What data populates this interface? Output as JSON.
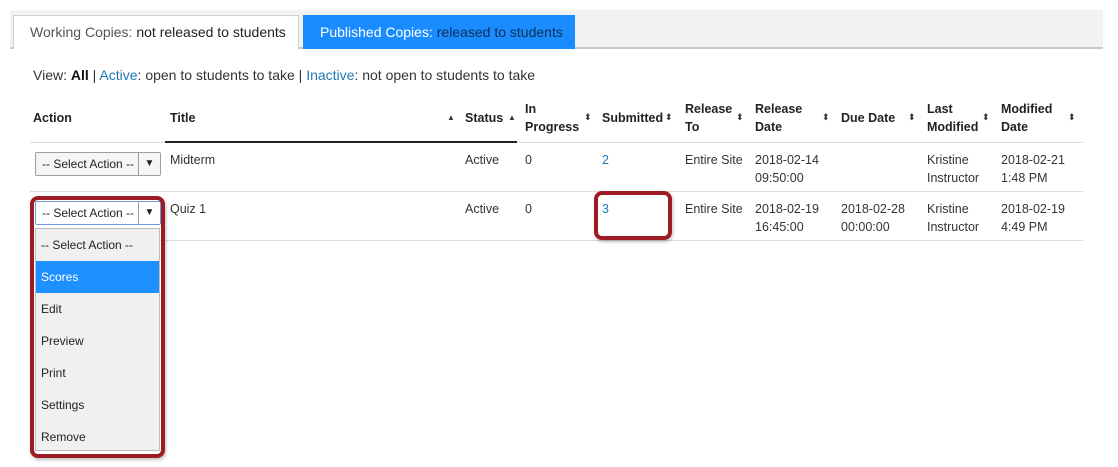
{
  "tabs": [
    {
      "name": "Working Copies:",
      "desc": " not released to students"
    },
    {
      "name": "Published Copies:",
      "desc": " released to students"
    }
  ],
  "view": {
    "prefix": "View: ",
    "all": "All",
    "sep1": " | ",
    "active_link": "Active",
    "active_desc": ": open to students to take",
    "sep2": " | ",
    "inactive_link": "Inactive",
    "inactive_desc": ": not open to students to take"
  },
  "table": {
    "headers": {
      "action": "Action",
      "title": "Title",
      "status": "Status",
      "in_progress_1": "In",
      "in_progress_2": "Progress",
      "submitted": "Submitted",
      "release_to_1": "Release",
      "release_to_2": "To",
      "release_date_1": "Release",
      "release_date_2": "Date",
      "due_date": "Due Date",
      "last_modified_1": "Last",
      "last_modified_2": "Modified",
      "modified_date_1": "Modified",
      "modified_date_2": "Date"
    },
    "rows": [
      {
        "action": "-- Select Action --",
        "title": "Midterm",
        "status": "Active",
        "in_progress": "0",
        "submitted": "2",
        "release_to": "Entire Site",
        "release_date_1": "2018-02-14",
        "release_date_2": "09:50:00",
        "due_date_1": "",
        "due_date_2": "",
        "last_modified_1": "Kristine",
        "last_modified_2": "Instructor",
        "modified_date_1": "2018-02-21",
        "modified_date_2": "1:48 PM"
      },
      {
        "action": "-- Select Action --",
        "title": "Quiz 1",
        "status": "Active",
        "in_progress": "0",
        "submitted": "3",
        "release_to": "Entire Site",
        "release_date_1": "2018-02-19",
        "release_date_2": "16:45:00",
        "due_date_1": "2018-02-28",
        "due_date_2": "00:00:00",
        "last_modified_1": "Kristine",
        "last_modified_2": "Instructor",
        "modified_date_1": "2018-02-19",
        "modified_date_2": "4:49 PM"
      }
    ]
  },
  "dropdown": {
    "options": [
      "-- Select Action --",
      "Scores",
      "Edit",
      "Preview",
      "Print",
      "Settings",
      "Remove"
    ],
    "selected": "Scores"
  },
  "colors": {
    "tab_active": "#1a8cff",
    "link": "#1f78b4",
    "highlight": "#9c1b24",
    "option_selected": "#1e90ff"
  },
  "icons": {
    "sort": "sort-both-icon",
    "sort_asc": "sort-asc-icon",
    "select_arrow": "chevron-down-icon"
  }
}
